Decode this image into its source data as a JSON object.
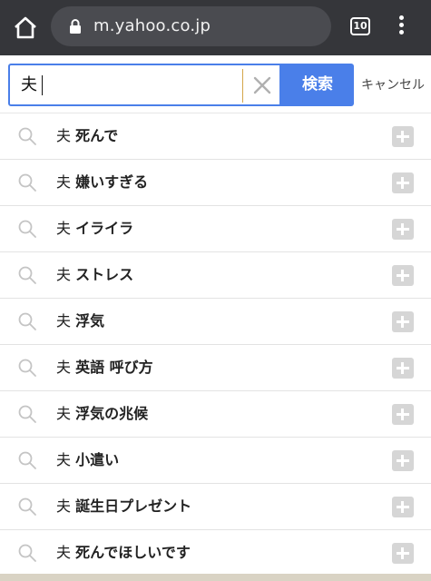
{
  "browser": {
    "url": "m.yahoo.co.jp",
    "tab_count": "10"
  },
  "search": {
    "query": "夫",
    "submit_label": "検索",
    "cancel_label": "キャンセル"
  },
  "suggestions": [
    {
      "prefix": "夫",
      "rest": "死んで"
    },
    {
      "prefix": "夫",
      "rest": "嫌いすぎる"
    },
    {
      "prefix": "夫",
      "rest": "イライラ"
    },
    {
      "prefix": "夫",
      "rest": "ストレス"
    },
    {
      "prefix": "夫",
      "rest": "浮気"
    },
    {
      "prefix": "夫",
      "rest": "英語 呼び方"
    },
    {
      "prefix": "夫",
      "rest": "浮気の兆候"
    },
    {
      "prefix": "夫",
      "rest": "小遣い"
    },
    {
      "prefix": "夫",
      "rest": "誕生日プレゼント"
    },
    {
      "prefix": "夫",
      "rest": "死んでほしいです"
    }
  ],
  "colors": {
    "chrome_bg": "#35363a",
    "accent_blue": "#4a7fe9",
    "plus_button": "#d6d6d6"
  },
  "icons": {
    "home": "home-icon",
    "lock": "lock-icon",
    "menu": "overflow-menu-icon",
    "clear": "close-icon",
    "suggestion": "search-icon",
    "append": "plus-icon"
  }
}
